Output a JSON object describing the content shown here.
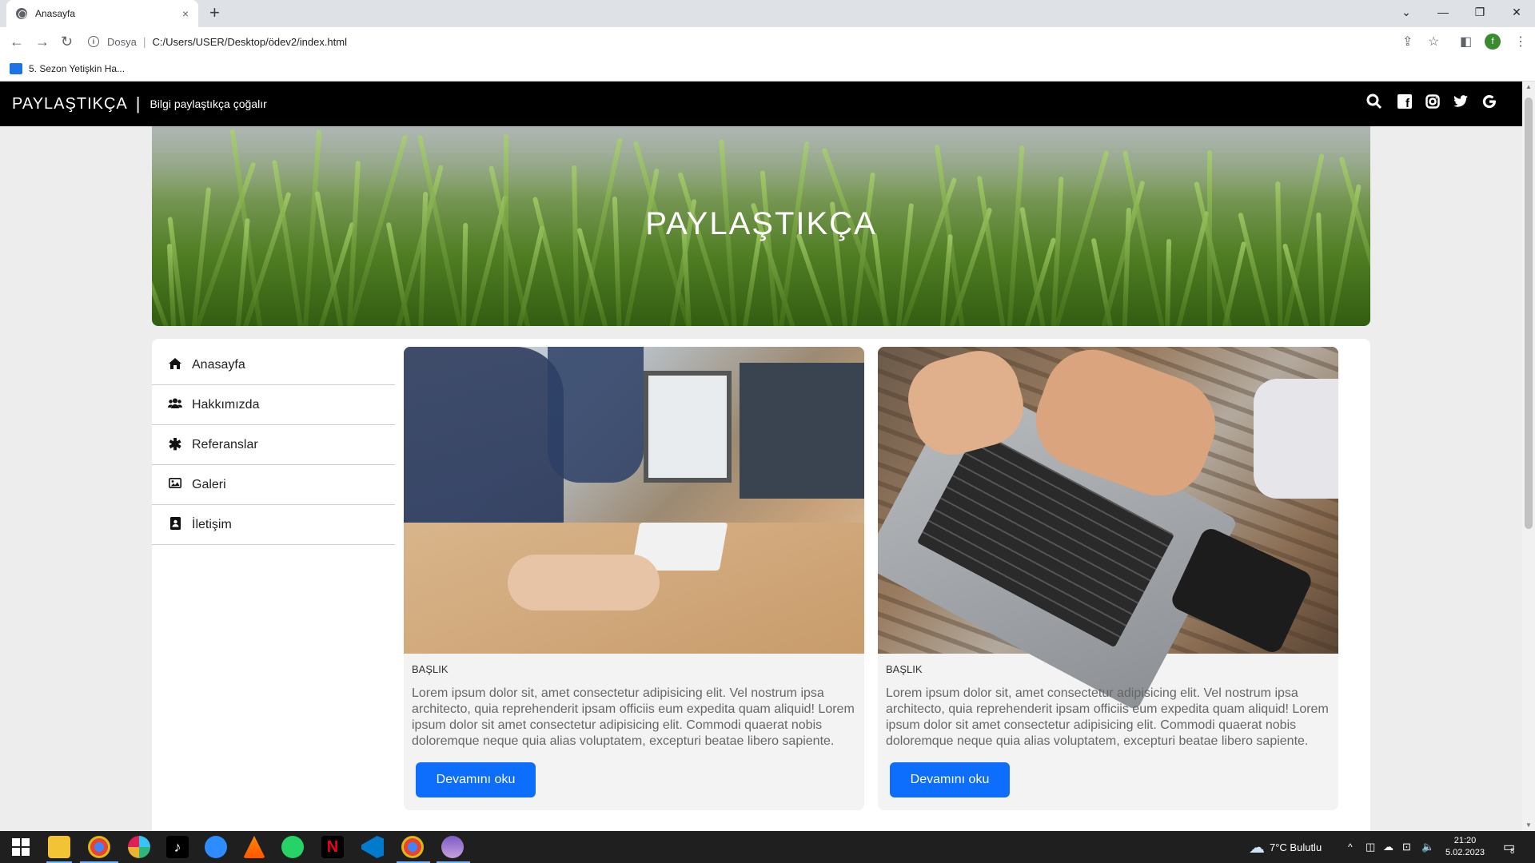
{
  "browser": {
    "tab_title": "Anasayfa",
    "tab_close": "×",
    "new_tab": "+",
    "url_scheme": "Dosya",
    "url": "C:/Users/USER/Desktop/ödev2/index.html",
    "profile_initial": "f",
    "bookmark": "5. Sezon Yetişkin Ha..."
  },
  "site": {
    "brand": "PAYLAŞTIKÇA",
    "tagline": "Bilgi paylaştıkça çoğalır",
    "hero_title": "PAYLAŞTIKÇA",
    "social": [
      {
        "icon": "search-icon",
        "glyph": "⚲"
      },
      {
        "icon": "facebook-icon",
        "glyph": "f"
      },
      {
        "icon": "instagram-icon",
        "glyph": "◎"
      },
      {
        "icon": "twitter-icon",
        "glyph": "🐦"
      },
      {
        "icon": "google-icon",
        "glyph": "G"
      }
    ],
    "menu": [
      {
        "label": "Anasayfa",
        "icon": "home-icon",
        "glyph": "⌂"
      },
      {
        "label": "Hakkımızda",
        "icon": "users-icon",
        "glyph": "👥"
      },
      {
        "label": "Referanslar",
        "icon": "asterisk-icon",
        "glyph": "✱"
      },
      {
        "label": "Galeri",
        "icon": "image-icon",
        "glyph": "🖼"
      },
      {
        "label": "İletişim",
        "icon": "contact-icon",
        "glyph": "▣"
      }
    ],
    "cards": [
      {
        "title": "BAŞLIK",
        "text": "Lorem ipsum dolor sit, amet consectetur adipisicing elit. Vel nostrum ipsa architecto, quia reprehenderit ipsam officiis eum expedita quam aliquid! Lorem ipsum dolor sit amet consectetur adipisicing elit. Commodi quaerat nobis doloremque neque quia alias voluptatem, excepturi beatae libero sapiente.",
        "button": "Devamını oku"
      },
      {
        "title": "BAŞLIK",
        "text": "Lorem ipsum dolor sit, amet consectetur adipisicing elit. Vel nostrum ipsa architecto, quia reprehenderit ipsam officiis eum expedita quam aliquid! Lorem ipsum dolor sit amet consectetur adipisicing elit. Commodi quaerat nobis doloremque neque quia alias voluptatem, excepturi beatae libero sapiente.",
        "button": "Devamını oku"
      }
    ]
  },
  "taskbar": {
    "weather": "7°C  Bulutlu",
    "time": "21:20",
    "date": "5.02.2023",
    "notifications": "8"
  },
  "colors": {
    "nav_bg": "#000000",
    "button_bg": "#0d6efd",
    "page_bg": "#ededed"
  }
}
